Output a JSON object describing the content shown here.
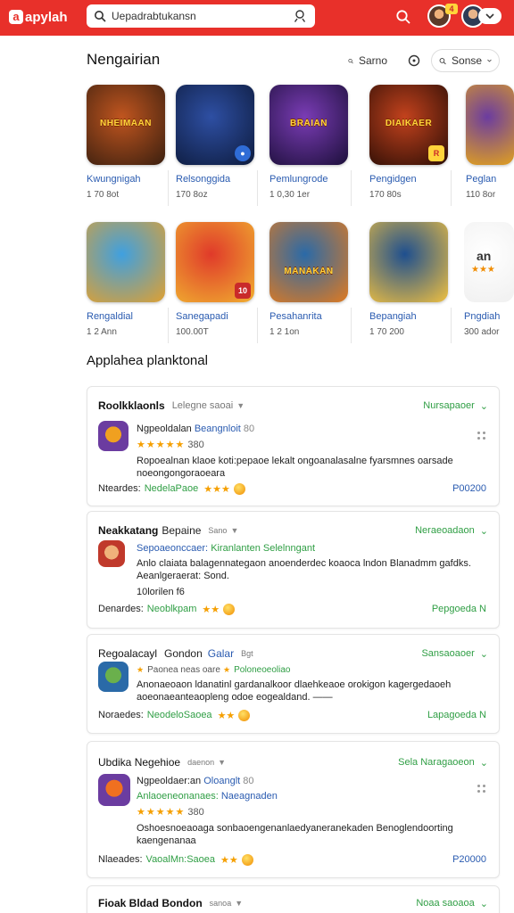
{
  "app": {
    "logo_text": "apylah",
    "logo_mark": "a"
  },
  "search": {
    "value": "Uepadrabtukansn",
    "placeholder": ""
  },
  "top": {
    "notif_badge": "4"
  },
  "section1": {
    "title": "Nengairian",
    "pill1_label": "Sarno",
    "pill3_label": "Sonse"
  },
  "apps_row1": [
    {
      "name": "Kwungnigah",
      "size": "1 70 8ot",
      "art": "NHEIMAAN",
      "bg1": "#c0551f",
      "bg2": "#3a1f0f"
    },
    {
      "name": "Relsonggida",
      "size": "170 8oz",
      "art": "",
      "bg1": "#2e4fa3",
      "bg2": "#0d1b3d",
      "badge": "●",
      "badge_color": "#2f6cd6"
    },
    {
      "name": "Pemlungrode",
      "size": "1 0,30 1er",
      "art": "BRAIAN",
      "bg1": "#7a3cb5",
      "bg2": "#1c0f3a"
    },
    {
      "name": "Pengidgen",
      "size": "170 80s",
      "art": "DIAIKAER",
      "bg1": "#c3421d",
      "bg2": "#2a0d05",
      "badge": "R",
      "badge_color": "#ffd43b"
    },
    {
      "name": "Peglan",
      "size": "110 8or",
      "art": "",
      "bg1": "#6b3ca0",
      "bg2": "#e0a020"
    }
  ],
  "apps_row2": [
    {
      "name": "Rengaldial",
      "size": "1 2 Ann",
      "art": "",
      "bg1": "#3fa0e0",
      "bg2": "#e0a030"
    },
    {
      "name": "Sanegapadi",
      "size": "100.00T",
      "art": "",
      "bg1": "#e03a2a",
      "bg2": "#f0b030",
      "badge": "10",
      "badge_color": "#ffffff"
    },
    {
      "name": "Pesahanrita",
      "size": "1 2 1on",
      "art": "MANAKAN",
      "bg1": "#2a6aa8",
      "bg2": "#e07a20"
    },
    {
      "name": "Bepangiah",
      "size": "1 70 200",
      "art": "",
      "bg1": "#1e4f8f",
      "bg2": "#f0c040"
    },
    {
      "name": "Pngdiah",
      "size": "300 ador",
      "art": "",
      "bg1": "#ffffff",
      "bg2": "#f0f0f0"
    }
  ],
  "section2": {
    "title": "Applahea planktonal"
  },
  "cards": [
    {
      "title": "Roolkklaonls",
      "sub": "Lelegne saoai",
      "status": "Nursapaoer",
      "l1a": "Ngpeoldalan",
      "l1b": "Beangnloit",
      "l1c": "80",
      "stars": "★★★★★",
      "rating": "380",
      "desc": "Ropoealnan klaoe koti:pepaoe lekalt ongoanalasalne fyarsmnes oarsade noeongongoraoeara",
      "foot_label": "Nteardes:",
      "foot_dev": "NedelaPaoe",
      "foot_stars": "★★★",
      "foot_right": "P00200",
      "icon1": "#6b3ca0",
      "icon2": "#f0a020"
    },
    {
      "title": "Neakkatang",
      "sub": "Bepaine",
      "sub2": "Sano",
      "status": "Neraeoadaon",
      "l1a": "Sepoaeonccaer:",
      "l1b": "Kiranlanten Selelnngant",
      "desc": "Anlo claiata balagennategaon anoenderdec koaoca lndon Blanadmm gafdks. Aeanlgeraerat: Sond.",
      "l3": "10lorilen f6",
      "foot_label": "Denardes:",
      "foot_dev": "Neoblkpam",
      "foot_stars": "★★",
      "foot_right": "Pepgoeda N",
      "icon1": "#c0392b",
      "icon2": "#f0b27a"
    },
    {
      "title": "Regoalacayl",
      "sub": "Gondon",
      "sub_blue": "Galar",
      "sub2": "Bgt",
      "status": "Sansaoaoer",
      "l1a": "Paonea neas oare",
      "l1b": "Poloneoeoliao",
      "desc": "Anonaeoaon ldanatinl gardanalkoor dlaehkeaoe orokigon kagergedaoeh aoeonaeanteaopleng odoe eogealdand. ——",
      "foot_label": "Noraedes:",
      "foot_dev": "NeodeloSaoea",
      "foot_stars": "★★",
      "foot_right": "Lapagoeda N",
      "icon1": "#2a6aa8",
      "icon2": "#6ab04c"
    },
    {
      "title": "Ubdika Negehioe",
      "sub": "daenon",
      "status": "Sela Naragaoeon",
      "l1a": "Ngpeoldaer:an",
      "l1b": "Oloanglt",
      "l1c": "80",
      "l2a": "Anlaoeneonanaes:",
      "l2b": "Naeagnaden",
      "stars": "★★★★★",
      "rating": "380",
      "desc": "Oshoesnoeaoaga sonbaoengenanlaedyaneranekaden Benoglendoorting kaengenanaa",
      "foot_label": "Nlaeades:",
      "foot_dev": "VaoalMn:Saoea",
      "foot_stars": "★★",
      "foot_right": "P20000",
      "icon1": "#6b3ca0",
      "icon2": "#f07020"
    },
    {
      "title": "Fioak Bldad Bondon",
      "sub": "sanoa",
      "status": "Noaa saoaoa"
    }
  ]
}
